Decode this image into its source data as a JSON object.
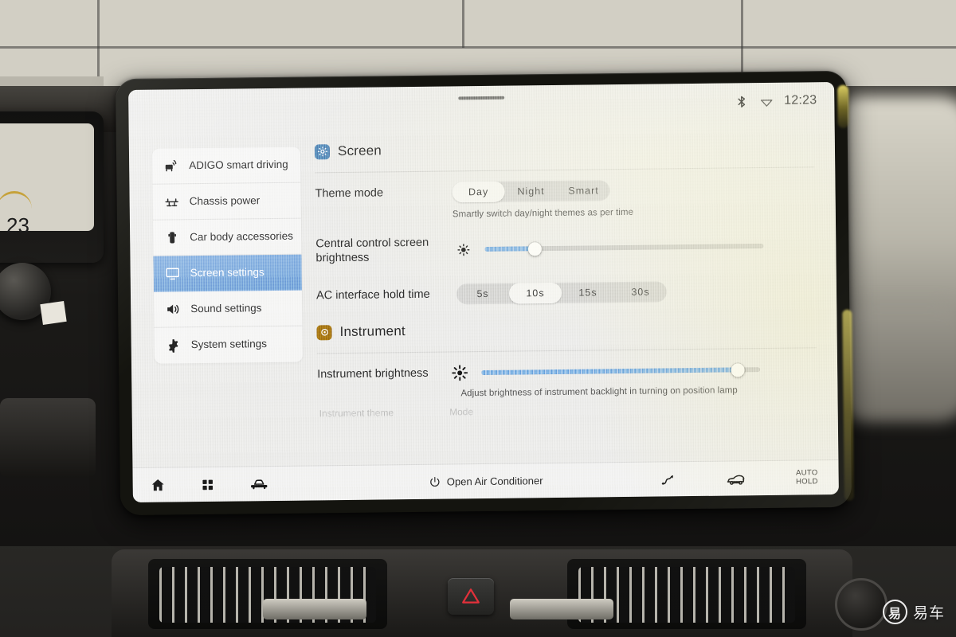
{
  "statusbar": {
    "bluetooth_icon": "bluetooth-icon",
    "wifi_icon": "wifi-icon",
    "time": "12:23"
  },
  "sidebar": {
    "items": [
      {
        "id": "adigo-smart-driving",
        "label": "ADIGO smart driving",
        "icon": "car-signal-icon",
        "active": false
      },
      {
        "id": "chassis-power",
        "label": "Chassis power",
        "icon": "chassis-icon",
        "active": false
      },
      {
        "id": "car-body-accessories",
        "label": "Car body accessories",
        "icon": "car-door-icon",
        "active": false
      },
      {
        "id": "screen-settings",
        "label": "Screen settings",
        "icon": "monitor-icon",
        "active": true
      },
      {
        "id": "sound-settings",
        "label": "Sound settings",
        "icon": "speaker-icon",
        "active": false
      },
      {
        "id": "system-settings",
        "label": "System settings",
        "icon": "gear-icon",
        "active": false
      }
    ]
  },
  "main": {
    "sections": [
      {
        "id": "screen",
        "title": "Screen",
        "badge_icon": "brightness-icon",
        "badge_color": "#4a79ae"
      },
      {
        "id": "instrument",
        "title": "Instrument",
        "badge_icon": "gauge-icon",
        "badge_color": "#9b6a14"
      }
    ],
    "theme_mode": {
      "label": "Theme mode",
      "options": [
        "Day",
        "Night",
        "Smart"
      ],
      "selected": "Day",
      "hint": "Smartly switch day/night themes as per time"
    },
    "central_brightness": {
      "label": "Central control screen brightness",
      "icon": "sun-small-icon",
      "value": 18,
      "min": 0,
      "max": 100
    },
    "ac_hold_time": {
      "label": "AC interface hold time",
      "options": [
        "5s",
        "10s",
        "15s",
        "30s"
      ],
      "selected": "10s"
    },
    "instrument_brightness": {
      "label": "Instrument brightness",
      "icon": "sun-large-icon",
      "value": 92,
      "min": 0,
      "max": 100,
      "hint": "Adjust brightness of instrument backlight in turning on position lamp"
    }
  },
  "dock": {
    "home_icon": "home-icon",
    "apps_icon": "grid-apps-icon",
    "car_icon": "car-front-icon",
    "ac_power_icon": "power-icon",
    "ac_label": "Open Air Conditioner",
    "seat_icon": "seat-adjust-icon",
    "trunk_icon": "car-trunk-icon",
    "auto_hold_line1": "AUTO",
    "auto_hold_line2": "HOLD"
  },
  "watermark": {
    "mark": "易",
    "text": "易车"
  }
}
